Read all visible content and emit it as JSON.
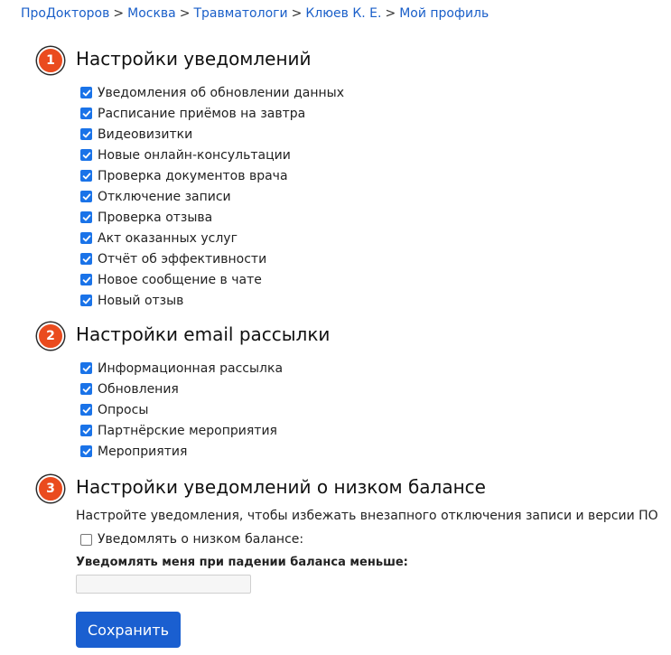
{
  "breadcrumb": [
    "ПроДокторов",
    "Москва",
    "Травматологи",
    "Клюев К. Е.",
    "Мой профиль"
  ],
  "breadcrumb_separator": ">",
  "sections": [
    {
      "number": "1",
      "title": "Настройки уведомлений",
      "items": [
        {
          "label": "Уведомления об обновлении данных",
          "checked": true
        },
        {
          "label": "Расписание приёмов на завтра",
          "checked": true
        },
        {
          "label": "Видеовизитки",
          "checked": true
        },
        {
          "label": "Новые онлайн-консультации",
          "checked": true
        },
        {
          "label": "Проверка документов врача",
          "checked": true
        },
        {
          "label": "Отключение записи",
          "checked": true
        },
        {
          "label": "Проверка отзыва",
          "checked": true
        },
        {
          "label": "Акт оказанных услуг",
          "checked": true
        },
        {
          "label": "Отчёт об эффективности",
          "checked": true
        },
        {
          "label": "Новое сообщение в чате",
          "checked": true
        },
        {
          "label": "Новый отзыв",
          "checked": true
        }
      ]
    },
    {
      "number": "2",
      "title": "Настройки email рассылки",
      "items": [
        {
          "label": "Информационная рассылка",
          "checked": true
        },
        {
          "label": "Обновления",
          "checked": true
        },
        {
          "label": "Опросы",
          "checked": true
        },
        {
          "label": "Партнёрские мероприятия",
          "checked": true
        },
        {
          "label": "Мероприятия",
          "checked": true
        }
      ]
    },
    {
      "number": "3",
      "title": "Настройки уведомлений о низком балансе",
      "description": "Настройте уведомления, чтобы избежать внезапного отключения записи и версии ПО",
      "low_balance_label": "Уведомлять о низком балансе:",
      "low_balance_checked": false,
      "threshold_label": "Уведомлять меня при падении баланса меньше:",
      "threshold_value": "",
      "threshold_placeholder": ""
    }
  ],
  "save_label": "Сохранить",
  "colors": {
    "link": "#1a5fc9",
    "badge": "#ea4b1e",
    "checkbox": "#1a73e8",
    "button": "#1a5fd0"
  }
}
